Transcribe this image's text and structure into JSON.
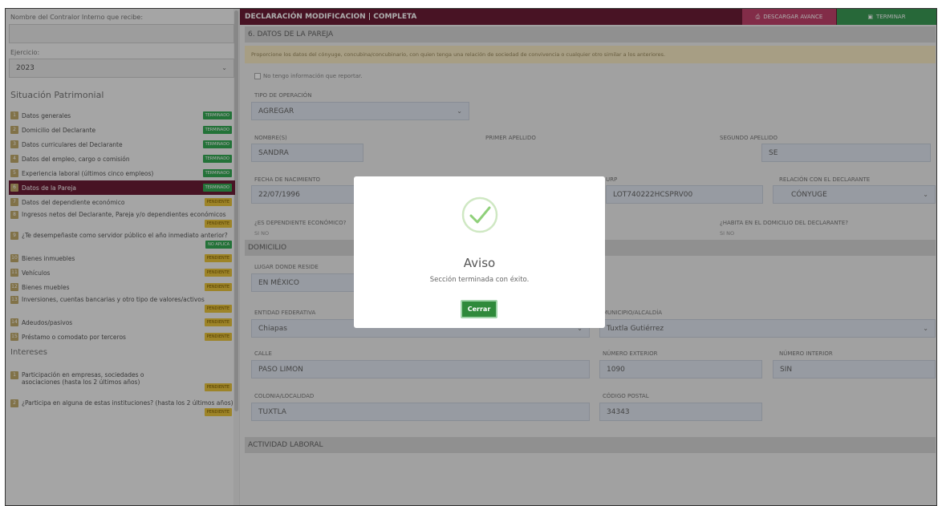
{
  "sidebar": {
    "contralor_label": "Nombre del Contralor Interno que recibe:",
    "ejercicio_label": "Ejercicio:",
    "ejercicio_value": "2023",
    "situacion_heading": "Situación Patrimonial",
    "items": [
      {
        "num": "1",
        "label": "Datos generales",
        "status": "TERMINADO"
      },
      {
        "num": "2",
        "label": "Domicilio del Declarante",
        "status": "TERMINADO"
      },
      {
        "num": "3",
        "label": "Datos curriculares del Declarante",
        "status": "TERMINADO"
      },
      {
        "num": "4",
        "label": "Datos del empleo, cargo o comisión",
        "status": "TERMINADO"
      },
      {
        "num": "5",
        "label": "Experiencia laboral (últimos cinco empleos)",
        "status": "TERMINADO"
      },
      {
        "num": "6",
        "label": "Datos de la Pareja",
        "status": "TERMINADO"
      },
      {
        "num": "7",
        "label": "Datos del dependiente económico",
        "status": "PENDIENTE"
      },
      {
        "num": "8",
        "label": "Ingresos netos del Declarante, Pareja y/o dependientes económicos",
        "status": "PENDIENTE"
      },
      {
        "num": "9",
        "label": "¿Te desempeñaste como servidor público el año inmediato anterior?",
        "status": "NO APLICA"
      },
      {
        "num": "10",
        "label": "Bienes inmuebles",
        "status": "PENDIENTE"
      },
      {
        "num": "11",
        "label": "Vehículos",
        "status": "PENDIENTE"
      },
      {
        "num": "12",
        "label": "Bienes muebles",
        "status": "PENDIENTE"
      },
      {
        "num": "13",
        "label": "Inversiones, cuentas bancarias y otro tipo de valores/activos",
        "status": "PENDIENTE"
      },
      {
        "num": "14",
        "label": "Adeudos/pasivos",
        "status": "PENDIENTE"
      },
      {
        "num": "15",
        "label": "Préstamo o comodato por terceros",
        "status": "PENDIENTE"
      }
    ],
    "intereses_heading": "Intereses",
    "intereses_items": [
      {
        "num": "1",
        "label": "Participación en empresas, sociedades o asociaciones (hasta los 2 últimos años)",
        "status": "PENDIENTE"
      },
      {
        "num": "2",
        "label": "¿Participa en alguna de estas instituciones? (hasta los 2 últimos años)",
        "status": "PENDIENTE"
      }
    ]
  },
  "header": {
    "title": "DECLARACIÓN MODIFICACION | COMPLETA",
    "download_label": "DESCARGAR AVANCE",
    "finish_label": "TERMINAR"
  },
  "form": {
    "section_title": "6. DATOS DE LA PAREJA",
    "notice": "Proporcione los datos del cónyuge, concubina/concubinario, con quien tenga una relación de sociedad de convivencia o cualquier otro similar a los anteriores.",
    "no_info_label": "No tengo información que reportar.",
    "tipo_operacion_label": "TIPO DE OPERACIÓN",
    "tipo_operacion_value": "AGREGAR",
    "nombre_label": "NOMBRE(S)",
    "nombre_value": "SANDRA",
    "primer_apellido_label": "PRIMER APELLIDO",
    "segundo_apellido_label": "SEGUNDO APELLIDO",
    "segundo_apellido_value": "SE",
    "fecha_label": "FECHA DE NACIMIENTO",
    "fecha_value": "22/07/1996",
    "curp_label": "URP",
    "curp_value": "LOT740222HCSPRV00",
    "relacion_label": "RELACIÓN CON EL DECLARANTE",
    "relacion_value": "CÓNYUGE",
    "dependiente_label": "¿ES DEPENDIENTE ECONÓMICO?",
    "dependiente_options": "SI NO",
    "habita_label": "¿HABITA EN EL DOMICILIO DEL DECLARANTE?",
    "habita_options": "SI NO",
    "domicilio_title": "DOMICILIO",
    "lugar_label": "LUGAR DONDE RESIDE",
    "lugar_value": "EN MÉXICO",
    "entidad_label": "ENTIDAD FEDERATIVA",
    "entidad_value": "Chiapas",
    "municipio_label": "MUNICIPIO/ALCALDÍA",
    "municipio_value": "Tuxtla Gutiérrez",
    "calle_label": "CALLE",
    "calle_value": "PASO LIMON",
    "num_ext_label": "NÚMERO EXTERIOR",
    "num_ext_value": "1090",
    "num_int_label": "NÚMERO INTERIOR",
    "num_int_value": "SIN",
    "colonia_label": "COLONIA/LOCALIDAD",
    "colonia_value": "TUXTLA",
    "cp_label": "CÓDIGO POSTAL",
    "cp_value": "34343",
    "actividad_title": "ACTIVIDAD LABORAL"
  },
  "modal": {
    "title": "Aviso",
    "message": "Sección terminada con éxito.",
    "close_label": "Cerrar"
  },
  "colors": {
    "brand": "#6b1d35",
    "success": "#3a9a55",
    "pending": "#e8c33b"
  }
}
